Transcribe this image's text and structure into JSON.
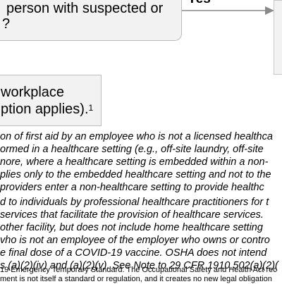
{
  "flowchart": {
    "question_box": {
      "line1": "person with suspected or",
      "line2": "?"
    },
    "yes_label": "Yes",
    "result_box": {
      "line1": "workplace",
      "line2": "ption applies).",
      "footnote_marker": "1"
    }
  },
  "footnotes": {
    "block1": [
      "on of first aid by an employee who is not a licensed healthca",
      "ormed in a healthcare setting (e.g., off-site laundry, off-site",
      "nore, where a healthcare setting is embedded within a non-",
      "plies only to the embedded healthcare setting and not to the",
      "providers enter a non-healthcare setting to provide healthc"
    ],
    "block2": [
      "d to individuals by professional healthcare practitioners for t",
      "services that facilitate the provision of healthcare services.",
      "other facility, but does not include home healthcare setting",
      "vho is not an employee of the employer who owns or contro",
      "e final dose of a COVID-19 vaccine. OSHA does not intend",
      "s (a)(2)(iv) and (a)(2)(v). See Note to 29 CFR 1910.502(a)(2)("
    ],
    "block3": [
      "19 Emergency Temporary Standard. The Occupational Safety and Health Act rec",
      "ment is not itself a standard or regulation, and it creates no new legal obligation"
    ]
  }
}
